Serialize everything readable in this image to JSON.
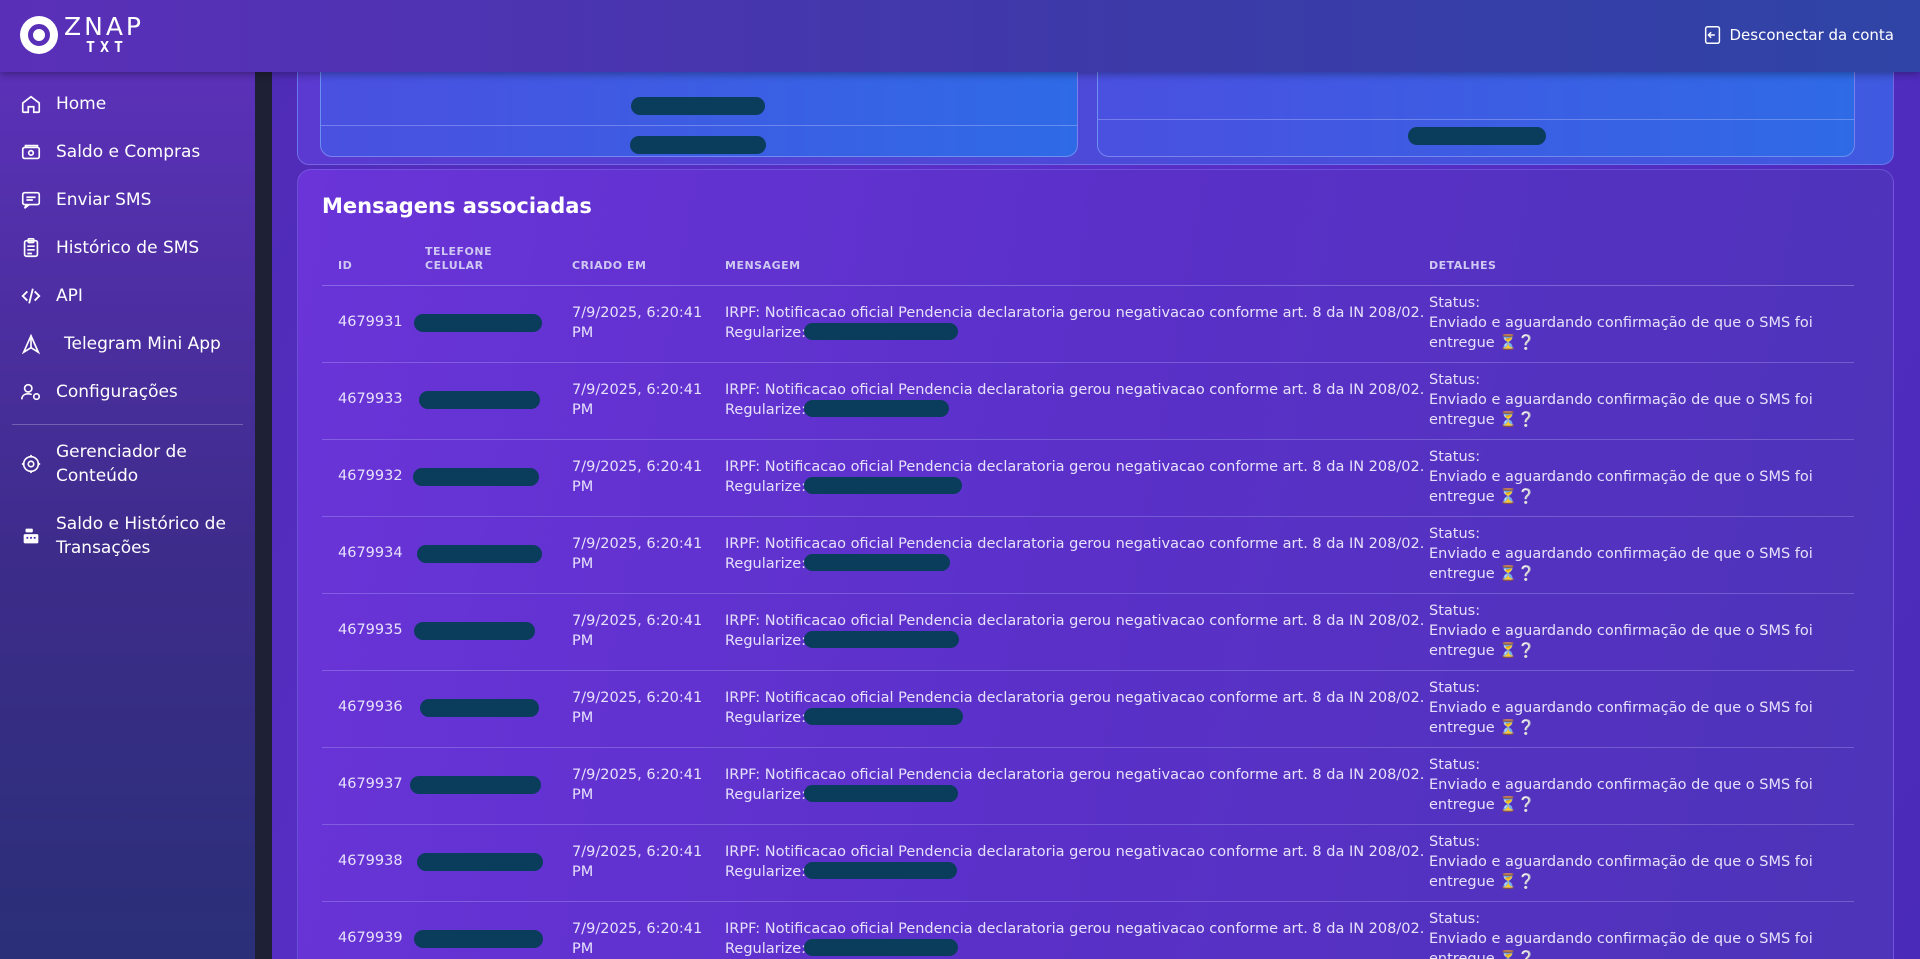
{
  "brand": {
    "name": "ZNAP",
    "sub": "TXT"
  },
  "header": {
    "logout_label": "Desconectar da conta"
  },
  "sidebar": {
    "items": [
      {
        "label": "Home",
        "icon": "home-icon"
      },
      {
        "label": "Saldo e Compras",
        "icon": "wallet-icon"
      },
      {
        "label": "Enviar SMS",
        "icon": "message-icon"
      },
      {
        "label": "Histórico de SMS",
        "icon": "clipboard-icon"
      },
      {
        "label": "API",
        "icon": "code-icon"
      },
      {
        "label": "Telegram Mini App",
        "icon": "telegram-icon"
      },
      {
        "label": "Configurações",
        "icon": "user-settings-icon"
      }
    ],
    "admin_items": [
      {
        "label": "Gerenciador de Conteúdo",
        "icon": "gear-icon"
      },
      {
        "label": "Saldo e Histórico de Transações",
        "icon": "cash-register-icon"
      }
    ]
  },
  "messages": {
    "title": "Mensagens associadas",
    "columns": {
      "id": "ID",
      "phone": "TELEFONE CELULAR",
      "created": "CRIADO EM",
      "message": "MENSAGEM",
      "details": "DETALHES"
    },
    "rows": [
      {
        "id": "4679931",
        "created": "7/9/2025, 6:20:41 PM",
        "message": "IRPF: Notificacao oficial Pendencia declaratoria gerou negativacao conforme art. 8 da IN 208/02. Regularize:",
        "status_label": "Status:",
        "status_text": "Enviado e aguardando confirmação de que o SMS foi entregue ⏳❔"
      },
      {
        "id": "4679933",
        "created": "7/9/2025, 6:20:41 PM",
        "message": "IRPF: Notificacao oficial Pendencia declaratoria gerou negativacao conforme art. 8 da IN 208/02. Regularize:",
        "status_label": "Status:",
        "status_text": "Enviado e aguardando confirmação de que o SMS foi entregue ⏳❔"
      },
      {
        "id": "4679932",
        "created": "7/9/2025, 6:20:41 PM",
        "message": "IRPF: Notificacao oficial Pendencia declaratoria gerou negativacao conforme art. 8 da IN 208/02. Regularize:",
        "status_label": "Status:",
        "status_text": "Enviado e aguardando confirmação de que o SMS foi entregue ⏳❔"
      },
      {
        "id": "4679934",
        "created": "7/9/2025, 6:20:41 PM",
        "message": "IRPF: Notificacao oficial Pendencia declaratoria gerou negativacao conforme art. 8 da IN 208/02. Regularize:",
        "status_label": "Status:",
        "status_text": "Enviado e aguardando confirmação de que o SMS foi entregue ⏳❔"
      },
      {
        "id": "4679935",
        "created": "7/9/2025, 6:20:41 PM",
        "message": "IRPF: Notificacao oficial Pendencia declaratoria gerou negativacao conforme art. 8 da IN 208/02. Regularize:",
        "status_label": "Status:",
        "status_text": "Enviado e aguardando confirmação de que o SMS foi entregue ⏳❔"
      },
      {
        "id": "4679936",
        "created": "7/9/2025, 6:20:41 PM",
        "message": "IRPF: Notificacao oficial Pendencia declaratoria gerou negativacao conforme art. 8 da IN 208/02. Regularize:",
        "status_label": "Status:",
        "status_text": "Enviado e aguardando confirmação de que o SMS foi entregue ⏳❔"
      },
      {
        "id": "4679937",
        "created": "7/9/2025, 6:20:41 PM",
        "message": "IRPF: Notificacao oficial Pendencia declaratoria gerou negativacao conforme art. 8 da IN 208/02. Regularize:",
        "status_label": "Status:",
        "status_text": "Enviado e aguardando confirmação de que o SMS foi entregue ⏳❔"
      },
      {
        "id": "4679938",
        "created": "7/9/2025, 6:20:41 PM",
        "message": "IRPF: Notificacao oficial Pendencia declaratoria gerou negativacao conforme art. 8 da IN 208/02. Regularize:",
        "status_label": "Status:",
        "status_text": "Enviado e aguardando confirmação de que o SMS foi entregue ⏳❔"
      },
      {
        "id": "4679939",
        "created": "7/9/2025, 6:20:41 PM",
        "message": "IRPF: Notificacao oficial Pendencia declaratoria gerou negativacao conforme art. 8 da IN 208/02. Regularize:",
        "status_label": "Status:",
        "status_text": "Enviado e aguardando confirmação de que o SMS foi entregue ⏳❔"
      }
    ]
  },
  "colors": {
    "redaction": "#0a3d5c",
    "accent": "#5b2fc9"
  }
}
